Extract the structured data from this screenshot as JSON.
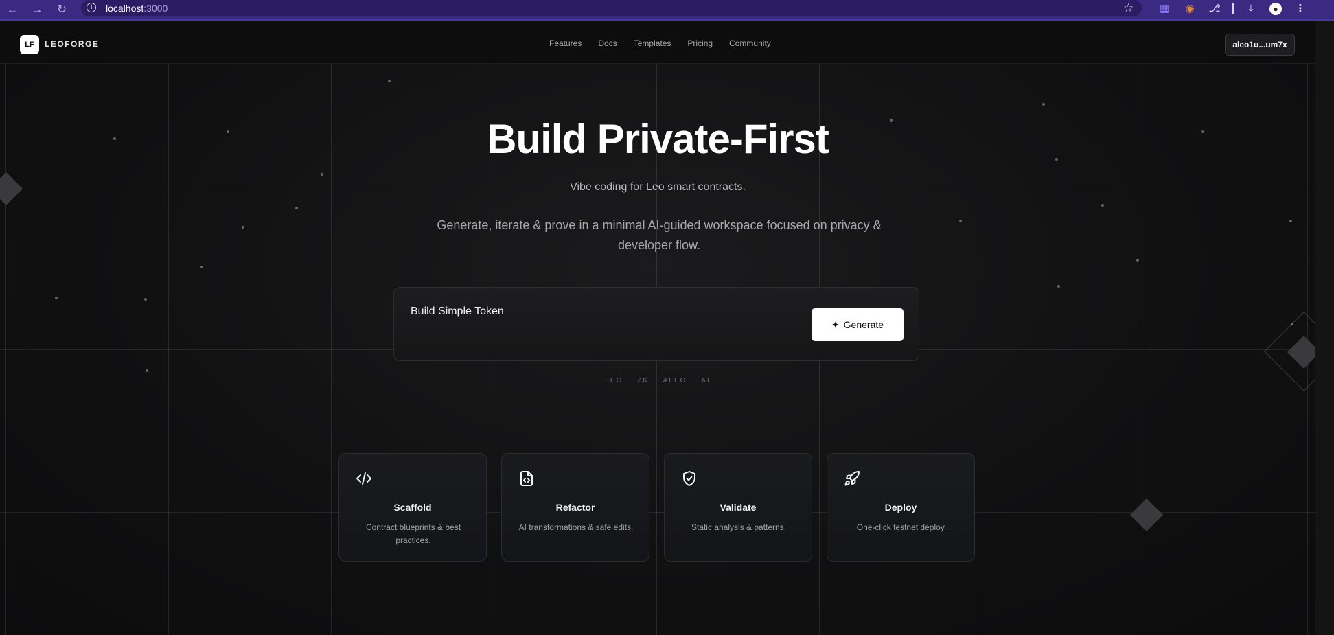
{
  "browser": {
    "url_host": "localhost",
    "url_port": ":3000"
  },
  "header": {
    "logo_mark": "LF",
    "logo_text": "LEOFORGE",
    "nav": [
      "Features",
      "Docs",
      "Templates",
      "Pricing",
      "Community"
    ],
    "wallet_label": "aleo1u...um7x"
  },
  "hero": {
    "title": "Build Private-First",
    "subtitle": "Vibe coding for Leo smart contracts.",
    "description": "Generate, iterate & prove in a minimal AI-guided workspace focused on privacy & developer flow."
  },
  "prompt": {
    "value": "Build Simple Token",
    "generate_label": "Generate"
  },
  "tags": [
    "LEO",
    "ZK",
    "ALEO",
    "AI"
  ],
  "features": [
    {
      "icon": "code-icon",
      "title": "Scaffold",
      "description": "Contract blueprints & best practices."
    },
    {
      "icon": "file-code-icon",
      "title": "Refactor",
      "description": "AI transformations & safe edits."
    },
    {
      "icon": "shield-check-icon",
      "title": "Validate",
      "description": "Static analysis & patterns."
    },
    {
      "icon": "rocket-icon",
      "title": "Deploy",
      "description": "One-click testnet deploy."
    }
  ]
}
